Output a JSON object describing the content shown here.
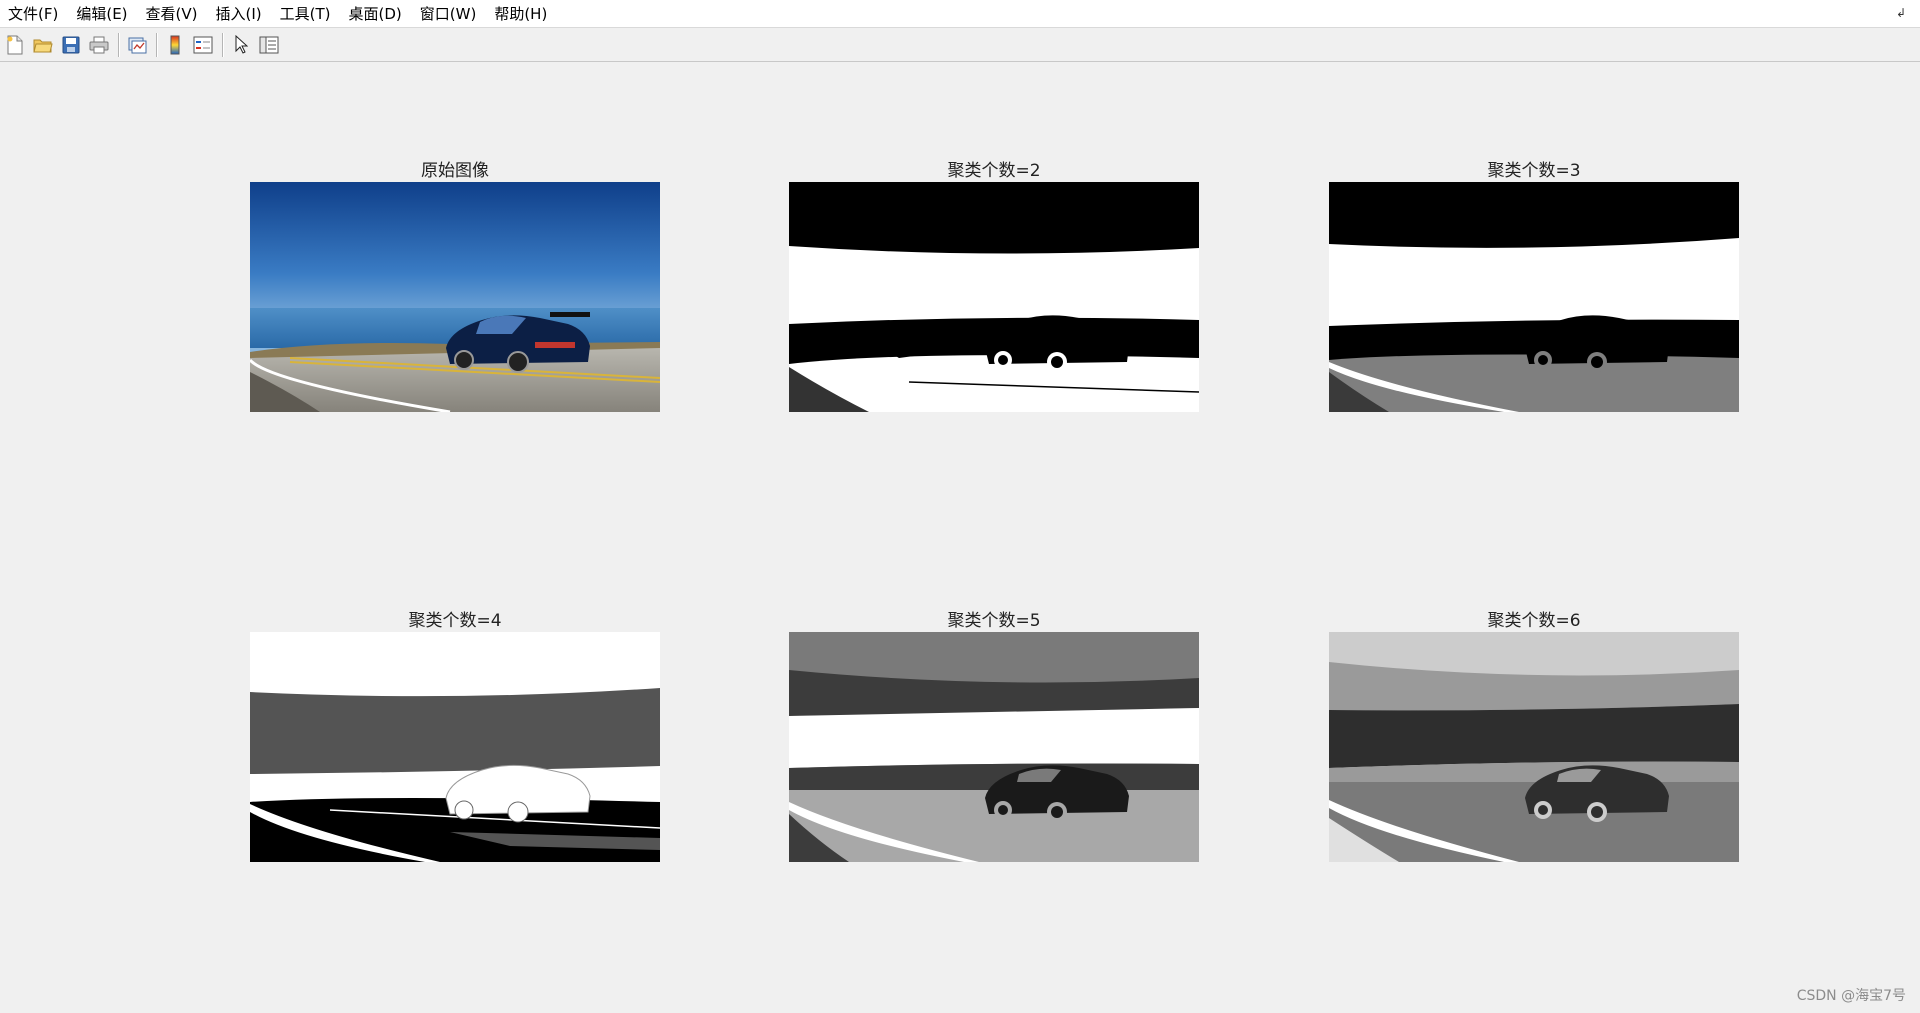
{
  "menu": {
    "items": [
      "文件(F)",
      "编辑(E)",
      "查看(V)",
      "插入(I)",
      "工具(T)",
      "桌面(D)",
      "窗口(W)",
      "帮助(H)"
    ],
    "dock_icon": "undock-arrow-icon"
  },
  "toolbar": {
    "buttons": [
      {
        "name": "new-figure-icon"
      },
      {
        "name": "open-file-icon"
      },
      {
        "name": "save-icon"
      },
      {
        "name": "print-icon"
      },
      {
        "name": "link-plot-icon"
      },
      {
        "name": "colorbar-icon"
      },
      {
        "name": "legend-icon"
      },
      {
        "name": "edit-plot-pointer-icon"
      },
      {
        "name": "property-inspector-icon"
      }
    ]
  },
  "subplots": [
    {
      "title": "原始图像",
      "kind": "original"
    },
    {
      "title": "聚类个数=2",
      "kind": "k2"
    },
    {
      "title": "聚类个数=3",
      "kind": "k3"
    },
    {
      "title": "聚类个数=4",
      "kind": "k4"
    },
    {
      "title": "聚类个数=5",
      "kind": "k5"
    },
    {
      "title": "聚类个数=6",
      "kind": "k6"
    }
  ],
  "watermark": "CSDN @海宝7号"
}
